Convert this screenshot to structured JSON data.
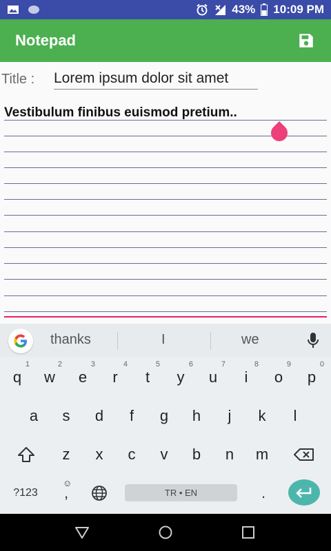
{
  "status_bar": {
    "battery": "43%",
    "time": "10:09 PM",
    "icons": [
      "image-icon",
      "circle-icon",
      "alarm-icon",
      "signal-icon",
      "battery-icon"
    ]
  },
  "app_bar": {
    "title": "Notepad",
    "save_icon": "save-icon",
    "color": "#4caf50"
  },
  "note": {
    "title_label": "Title :",
    "title_value": "Lorem ipsum dolor sit amet",
    "body_text": "Vestibulum finibus euismod pretium.."
  },
  "keyboard": {
    "suggestions": [
      "thanks",
      "I",
      "we"
    ],
    "row1": [
      {
        "label": "q",
        "hint": "1"
      },
      {
        "label": "w",
        "hint": "2"
      },
      {
        "label": "e",
        "hint": "3"
      },
      {
        "label": "r",
        "hint": "4"
      },
      {
        "label": "t",
        "hint": "5"
      },
      {
        "label": "y",
        "hint": "6"
      },
      {
        "label": "u",
        "hint": "7"
      },
      {
        "label": "i",
        "hint": "8"
      },
      {
        "label": "o",
        "hint": "9"
      },
      {
        "label": "p",
        "hint": "0"
      }
    ],
    "row2": [
      "a",
      "s",
      "d",
      "f",
      "g",
      "h",
      "j",
      "k",
      "l"
    ],
    "row3": [
      "z",
      "x",
      "c",
      "v",
      "b",
      "n",
      "m"
    ],
    "symbols_label": "?123",
    "emoji_label": ",",
    "space_label": "TR • EN",
    "period_label": ".",
    "accent_color": "#4db6ac"
  },
  "nav_bar": {
    "icons": [
      "back-icon",
      "home-icon",
      "recents-icon"
    ]
  }
}
